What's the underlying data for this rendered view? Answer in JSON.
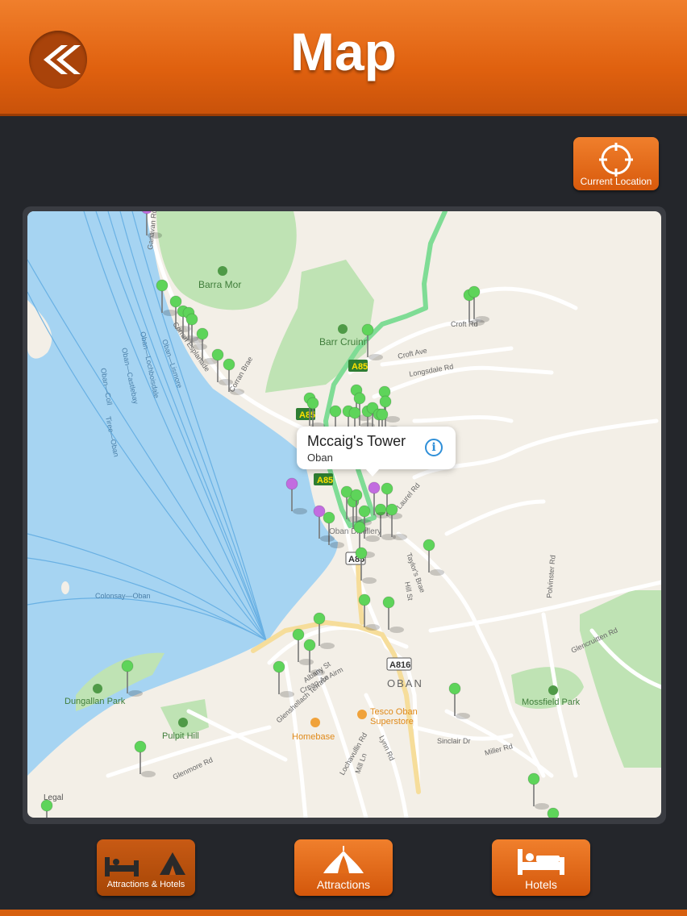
{
  "header": {
    "title": "Map"
  },
  "toolbar": {
    "current_location_label": "Current Location"
  },
  "map": {
    "callout": {
      "title": "Mccaig's Tower",
      "subtitle": "Oban"
    },
    "legal": "Legal",
    "labels": {
      "barra_mor": "Barra Mor",
      "barr_cruinn": "Barr Cruinn",
      "dungallan_park": "Dungallan Park",
      "pulpit_hill": "Pulpit Hill",
      "mossfield_park": "Mossfield Park",
      "oban": "OBAN",
      "homebase": "Homebase",
      "tesco_1": "Tesco Oban",
      "tesco_2": "Superstore",
      "distillery": "Oban Distillery",
      "a85_1": "A85",
      "a85_2": "A85",
      "a85_3": "A85",
      "a85_4": "A85",
      "a816": "A816",
      "ganavan_rd": "Ganavan Rd",
      "corran_esplanade": "Corran Esplanade",
      "corran_brae": "Corran Brae",
      "croft_rd": "Croft Rd",
      "croft_ave": "Croft Ave",
      "longsdale_rd": "Longsdale Rd",
      "laurel_rd": "Laurel Rd",
      "taylors_brae": "Taylor's Brae",
      "hill_st": "Hill St",
      "polvinster_rd": "Polvinster Rd",
      "glencruitten_rd": "Glencruitten Rd",
      "albany_st": "Albany St",
      "creag_an_airm": "Creag-An Airm",
      "glenshellach_terrace": "Glenshellach Terrace",
      "glenmore_rd": "Glenmore Rd",
      "lochavullin_rd": "Lochavullin Rd",
      "lynn_rd": "Lynn Rd",
      "mill_ln": "Mill Ln",
      "sinclair_dr": "Sinclair Dr",
      "miller_rd": "Miller Rd",
      "ferry_lismore": "Oban—Lismore",
      "ferry_lochboisdale": "Oban—Lochboisdale",
      "ferry_castlebay": "Oban—Castlebay",
      "ferry_coll": "Oban—Coll",
      "ferry_tiree": "Tiree—Oban",
      "ferry_colonsay": "Colonsay—Oban"
    }
  },
  "tabs": {
    "attractions_hotels": "Attractions & Hotels",
    "attractions": "Attractions",
    "hotels": "Hotels"
  },
  "colors": {
    "accent": "#e8701c",
    "water": "#a6d4f2",
    "park": "#bfe3b4",
    "pin_green": "#5ed45a",
    "pin_purple": "#c26ce0"
  }
}
